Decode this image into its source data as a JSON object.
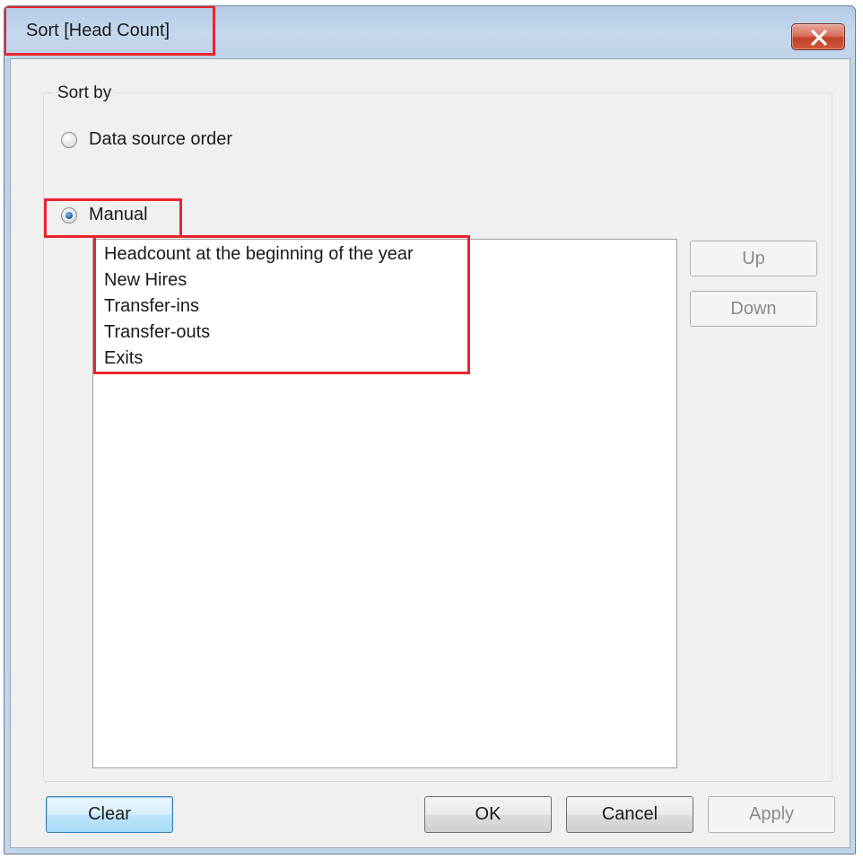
{
  "window": {
    "title": "Sort [Head Count]",
    "close_icon": "close-icon"
  },
  "sort_by": {
    "group_label": "Sort by",
    "options": [
      {
        "label": "Data source order",
        "selected": false
      },
      {
        "label": "Manual",
        "selected": true
      }
    ]
  },
  "manual_list": {
    "items": [
      "Headcount at the beginning of the year",
      "New Hires",
      "Transfer-ins",
      "Transfer-outs",
      "Exits"
    ]
  },
  "side_buttons": {
    "up_label": "Up",
    "down_label": "Down"
  },
  "footer": {
    "clear_label": "Clear",
    "ok_label": "OK",
    "cancel_label": "Cancel",
    "apply_label": "Apply"
  },
  "colors": {
    "highlight": "#e8252f",
    "title_bar": "#bfd3ea",
    "dialog_bg": "#f0f0f0"
  }
}
